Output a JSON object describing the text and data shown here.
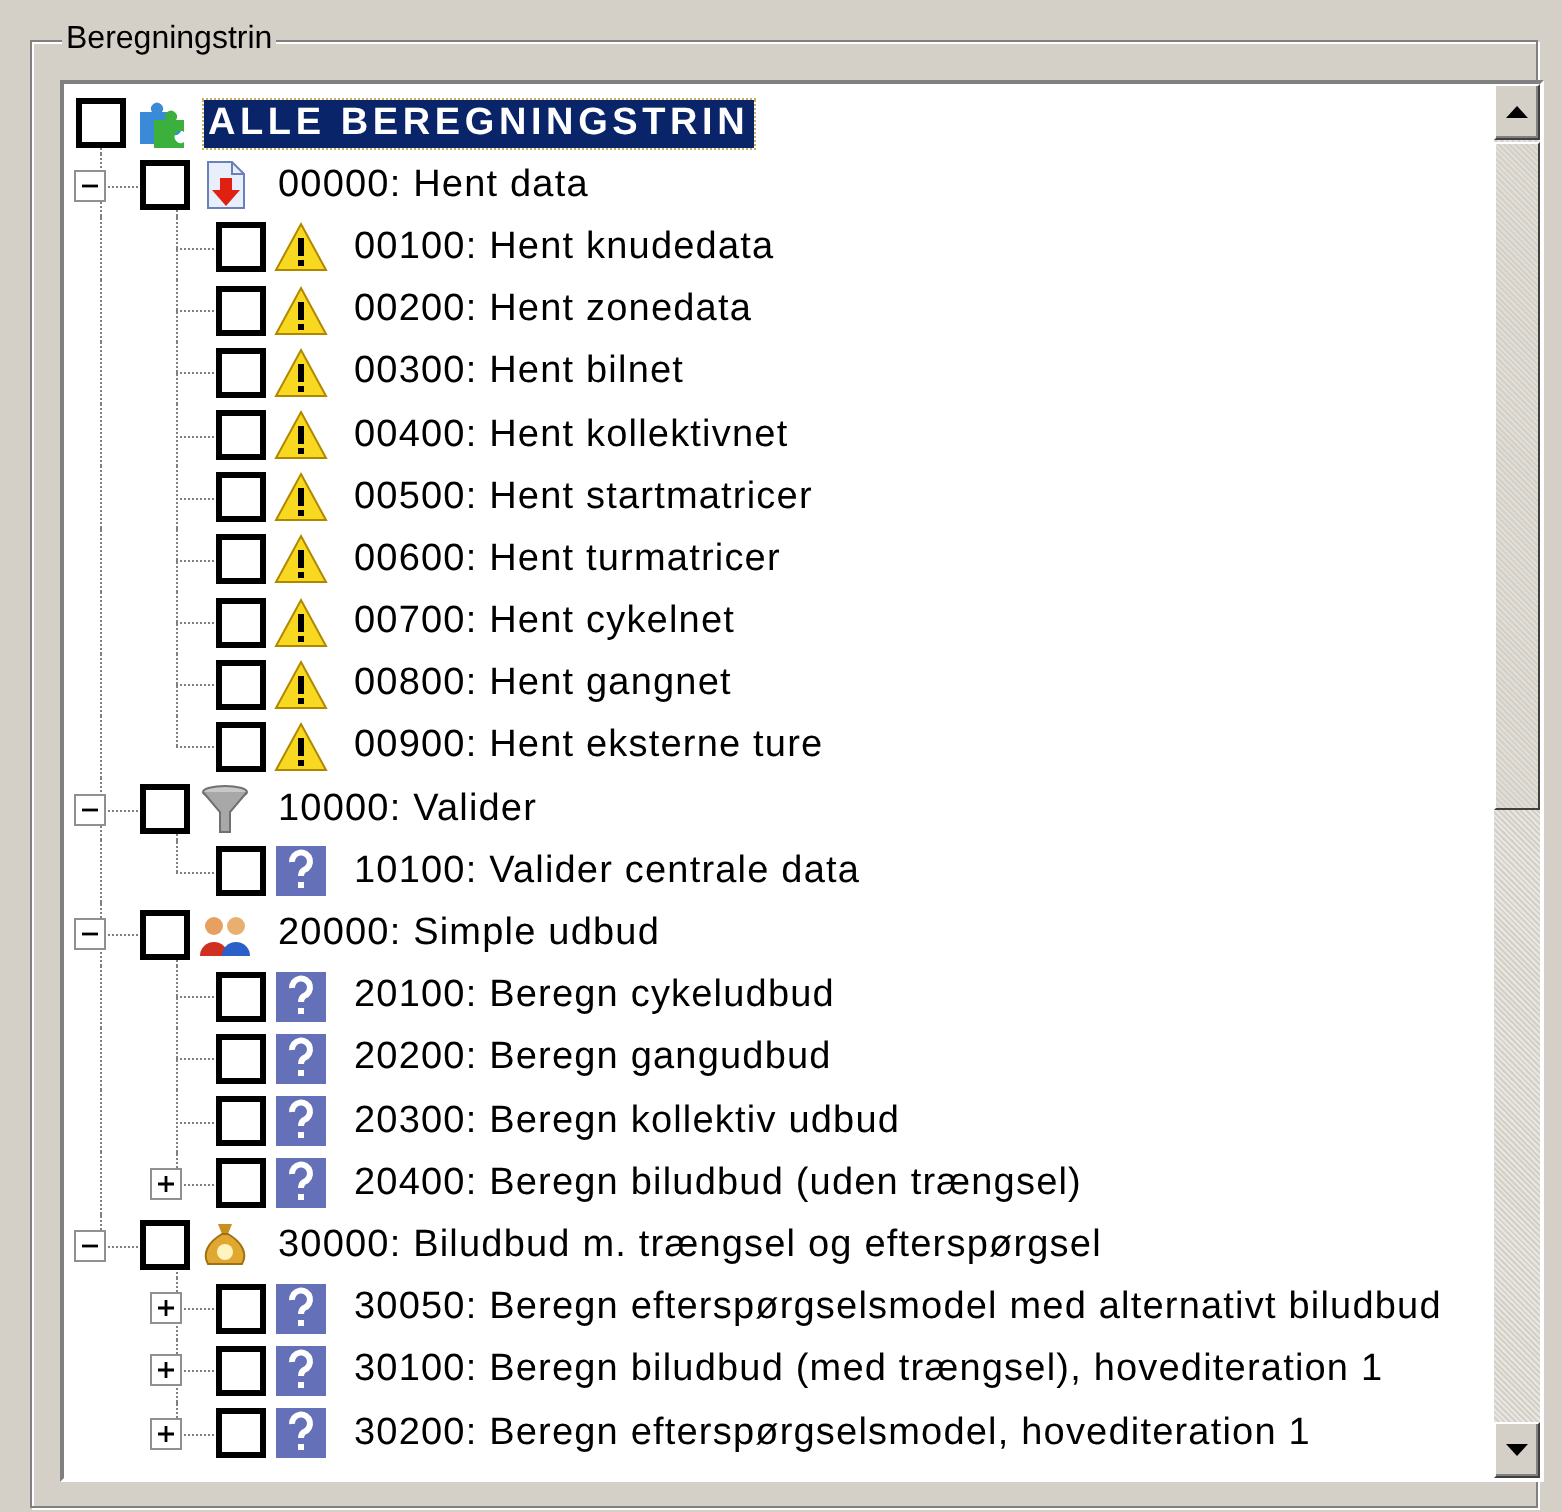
{
  "group_title": "Beregningstrin",
  "tree": {
    "label": "ALLE BEREGNINGSTRIN",
    "kind": "puzzle",
    "checked": false,
    "selected": true,
    "children": [
      {
        "label": "00000: Hent data",
        "kind": "download",
        "checked": false,
        "selected": false,
        "expanded": true,
        "children": [
          {
            "label": "00100: Hent knudedata",
            "kind": "warning",
            "checked": false,
            "selected": false
          },
          {
            "label": "00200: Hent zonedata",
            "kind": "warning",
            "checked": false,
            "selected": false
          },
          {
            "label": "00300: Hent bilnet",
            "kind": "warning",
            "checked": false,
            "selected": false
          },
          {
            "label": "00400: Hent kollektivnet",
            "kind": "warning",
            "checked": false,
            "selected": false
          },
          {
            "label": "00500: Hent startmatricer",
            "kind": "warning",
            "checked": false,
            "selected": false
          },
          {
            "label": "00600: Hent turmatricer",
            "kind": "warning",
            "checked": false,
            "selected": false
          },
          {
            "label": "00700: Hent cykelnet",
            "kind": "warning",
            "checked": false,
            "selected": false
          },
          {
            "label": "00800: Hent gangnet",
            "kind": "warning",
            "checked": false,
            "selected": false
          },
          {
            "label": "00900: Hent eksterne ture",
            "kind": "warning",
            "checked": false,
            "selected": false
          }
        ]
      },
      {
        "label": "10000: Valider",
        "kind": "funnel",
        "checked": false,
        "selected": false,
        "expanded": true,
        "children": [
          {
            "label": "10100: Valider centrale data",
            "kind": "question",
            "checked": false,
            "selected": false
          }
        ]
      },
      {
        "label": "20000: Simple udbud",
        "kind": "people",
        "checked": false,
        "selected": false,
        "expanded": true,
        "children": [
          {
            "label": "20100: Beregn cykeludbud",
            "kind": "question",
            "checked": false,
            "selected": false
          },
          {
            "label": "20200: Beregn gangudbud",
            "kind": "question",
            "checked": false,
            "selected": false
          },
          {
            "label": "20300: Beregn kollektiv udbud",
            "kind": "question",
            "checked": false,
            "selected": false
          },
          {
            "label": "20400: Beregn biludbud (uden trængsel)",
            "kind": "question",
            "checked": false,
            "selected": false,
            "expanded": false
          }
        ]
      },
      {
        "label": "30000: Biludbud m. trængsel og efterspørgsel",
        "kind": "moneybag",
        "checked": false,
        "selected": false,
        "expanded": true,
        "children": [
          {
            "label": "30050: Beregn efterspørgselsmodel med alternativt biludbud",
            "kind": "question",
            "checked": false,
            "selected": false,
            "expanded": false
          },
          {
            "label": "30100: Beregn biludbud (med trængsel), hovediteration 1",
            "kind": "question",
            "checked": false,
            "selected": false,
            "expanded": false
          },
          {
            "label": "30200: Beregn efterspørgselsmodel, hovediteration 1",
            "kind": "question",
            "checked": false,
            "selected": false,
            "expanded": false
          }
        ]
      }
    ]
  }
}
